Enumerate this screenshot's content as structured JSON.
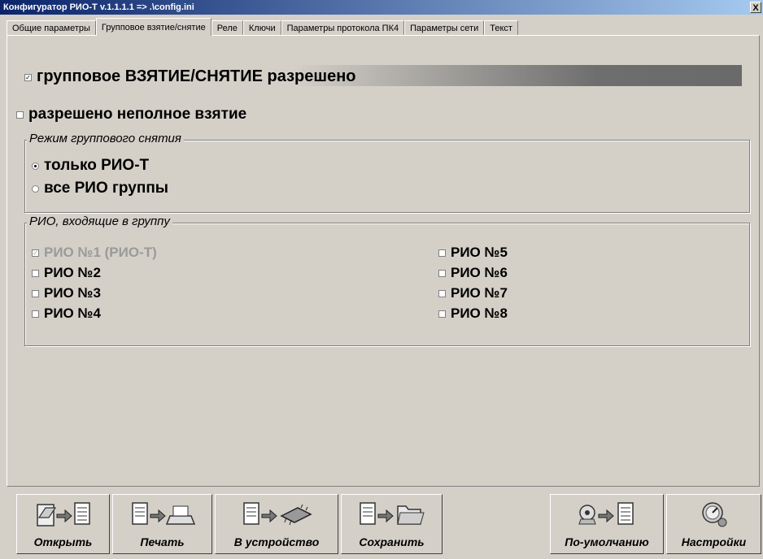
{
  "window": {
    "title": "Конфигуратор РИО-Т v.1.1.1.1  =>  .\\config.ini",
    "close_label": "X"
  },
  "tabs": [
    {
      "label": "Общие параметры"
    },
    {
      "label": "Групповое взятие/снятие",
      "active": true
    },
    {
      "label": "Реле"
    },
    {
      "label": "Ключи"
    },
    {
      "label": "Параметры протокола ПК4"
    },
    {
      "label": "Параметры сети"
    },
    {
      "label": "Текст"
    }
  ],
  "group_arm": {
    "label": "групповое ВЗЯТИЕ/СНЯТИЕ разрешено",
    "checked": true
  },
  "partial_arm": {
    "label": "разрешено неполное взятие",
    "checked": false
  },
  "disarm_mode": {
    "title": "Режим группового снятия",
    "options": [
      {
        "label": "только РИО-Т",
        "selected": true
      },
      {
        "label": "все РИО группы",
        "selected": false
      }
    ]
  },
  "rio_group": {
    "title": "РИО, входящие в группу",
    "items": [
      {
        "label": "РИО №1 (РИО-Т)",
        "checked": true,
        "disabled": true
      },
      {
        "label": "РИО №2",
        "checked": false
      },
      {
        "label": "РИО №3",
        "checked": false
      },
      {
        "label": "РИО №4",
        "checked": false
      },
      {
        "label": "РИО №5",
        "checked": false
      },
      {
        "label": "РИО №6",
        "checked": false
      },
      {
        "label": "РИО №7",
        "checked": false
      },
      {
        "label": "РИО №8",
        "checked": false
      }
    ]
  },
  "toolbar": {
    "open": "Открыть",
    "print": "Печать",
    "to_device": "В устройство",
    "save": "Сохранить",
    "defaults": "По-умолчанию",
    "settings": "Настройки"
  },
  "icons": {
    "open": "open-file-icon",
    "print": "printer-icon",
    "to_device": "chip-icon",
    "save": "folder-icon",
    "defaults": "reset-defaults-icon",
    "settings": "gauge-settings-icon"
  },
  "colors": {
    "titlebar": "#0b246a",
    "face": "#d4d0c8",
    "disabled_text": "#9a9a9a"
  }
}
